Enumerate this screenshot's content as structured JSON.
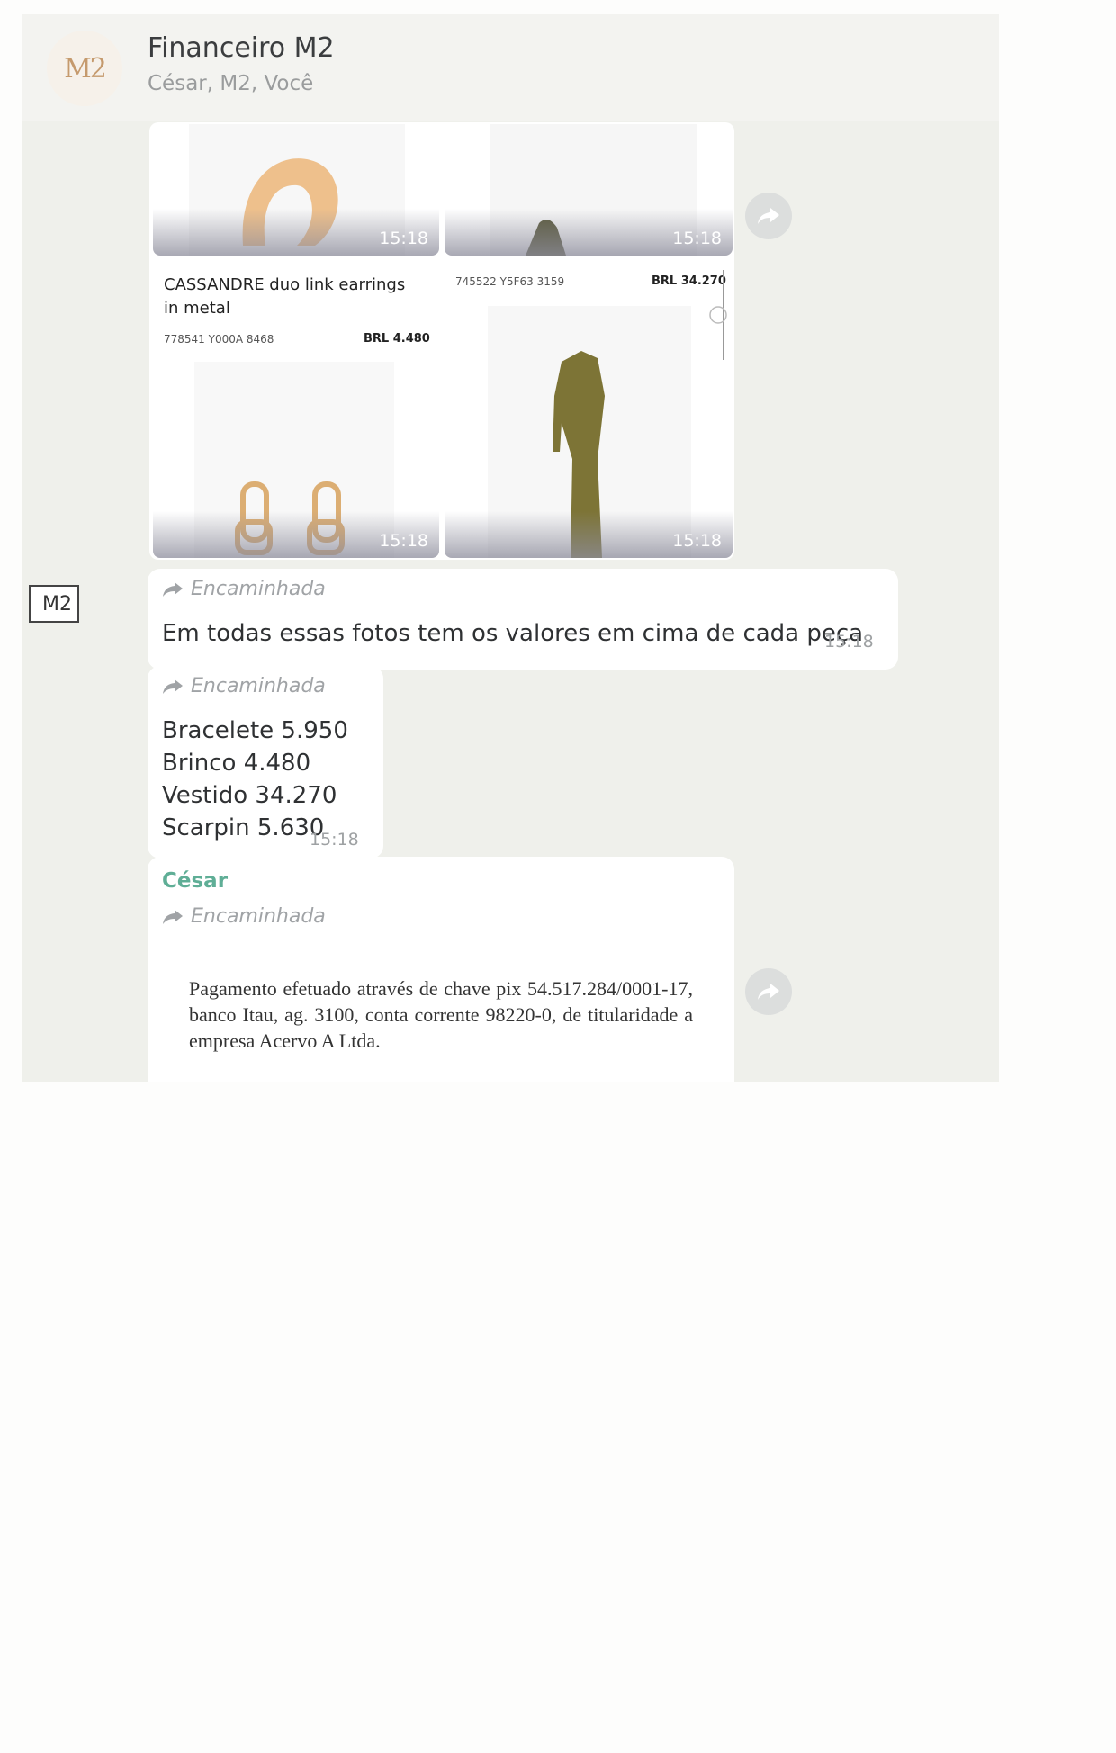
{
  "header": {
    "avatar_text": "M2",
    "title": "Financeiro M2",
    "participants": "César, M2, Você"
  },
  "media": {
    "tiles": [
      {
        "time": "15:18"
      },
      {
        "time": "15:18"
      },
      {
        "time": "15:18",
        "product_title": "CASSANDRE duo link earrings in metal",
        "ref": "778541 Y000A 8468",
        "price": "BRL 4.480"
      },
      {
        "time": "15:18",
        "ref": "745522 Y5F63 3159",
        "price": "BRL 34.270"
      }
    ]
  },
  "side_tag": "M2",
  "forwarded_label": "Encaminhada",
  "messages": {
    "m1": {
      "text": "Em todas essas fotos tem os valores em cima de cada peça",
      "time": "15:18"
    },
    "m2": {
      "lines": [
        "Bracelete 5.950",
        "Brinco 4.480",
        "Vestido 34.270",
        "Scarpin 5.630"
      ],
      "time": "15:18"
    },
    "m3": {
      "sender": "César",
      "doc_text": "Pagamento efetuado através de chave pix 54.517.284/0001-17, banco Itau, ag. 3100, conta corrente 98220-0, de titularidade a empresa Acervo A Ltda."
    }
  },
  "colors": {
    "sender": "#5fae96",
    "dress": "#7d7436",
    "gold": "#e0b47a"
  }
}
